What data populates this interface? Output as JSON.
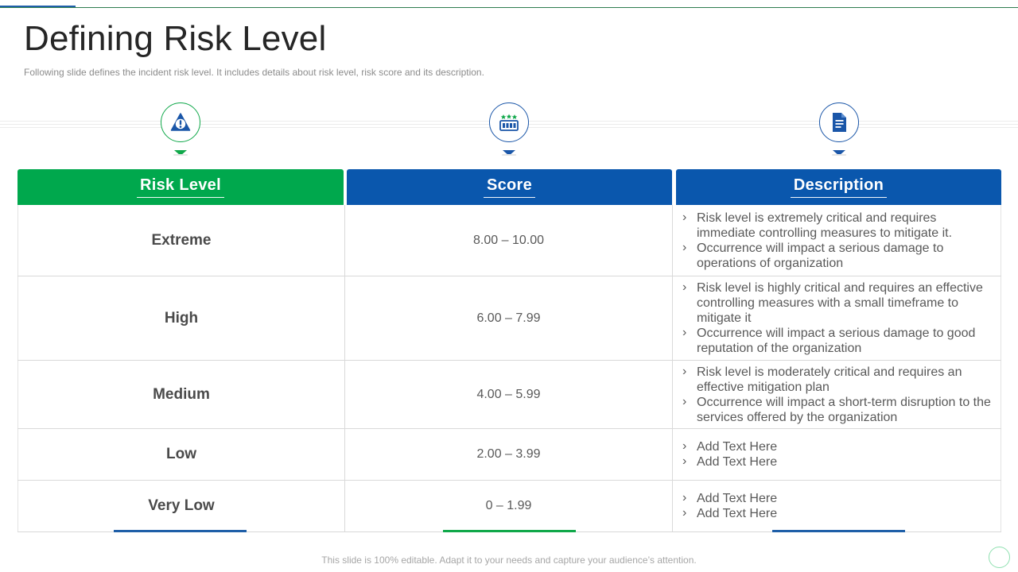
{
  "slide": {
    "title": "Defining Risk Level",
    "subtitle": "Following slide defines the incident risk level. It includes details about risk level, risk score and its description.",
    "footer": "This slide is 100% editable. Adapt it to your needs and capture your audience’s attention."
  },
  "icons": [
    {
      "name": "warning-triangle-icon",
      "color": "#10a84a"
    },
    {
      "name": "scoreboard-icon",
      "color": "#1a56a8"
    },
    {
      "name": "document-icon",
      "color": "#1a56a8"
    }
  ],
  "table": {
    "headers": [
      "Risk Level",
      "Score",
      "Description"
    ],
    "header_colors": [
      "#00a84d",
      "#0a57ad",
      "#0a57ad"
    ],
    "rows": [
      {
        "level": "Extreme",
        "score": "8.00 – 10.00",
        "description": [
          "Risk level is extremely critical and requires immediate controlling measures to mitigate it.",
          "Occurrence will impact a serious damage to operations of organization"
        ]
      },
      {
        "level": "High",
        "score": "6.00 – 7.99",
        "description": [
          "Risk level is highly critical and requires  an effective controlling measures with a small timeframe to mitigate it",
          "Occurrence will impact a serious damage to good reputation of the organization"
        ]
      },
      {
        "level": "Medium",
        "score": "4.00 – 5.99",
        "description": [
          "Risk level is moderately critical and requires an effective mitigation plan",
          "Occurrence will impact a short-term disruption to the services offered by the organization"
        ]
      },
      {
        "level": "Low",
        "score": "2.00 – 3.99",
        "description": [
          "Add Text Here",
          "Add Text Here"
        ]
      },
      {
        "level": "Very Low",
        "score": "0 – 1.99",
        "description": [
          "Add Text Here",
          "Add Text Here"
        ]
      }
    ]
  }
}
